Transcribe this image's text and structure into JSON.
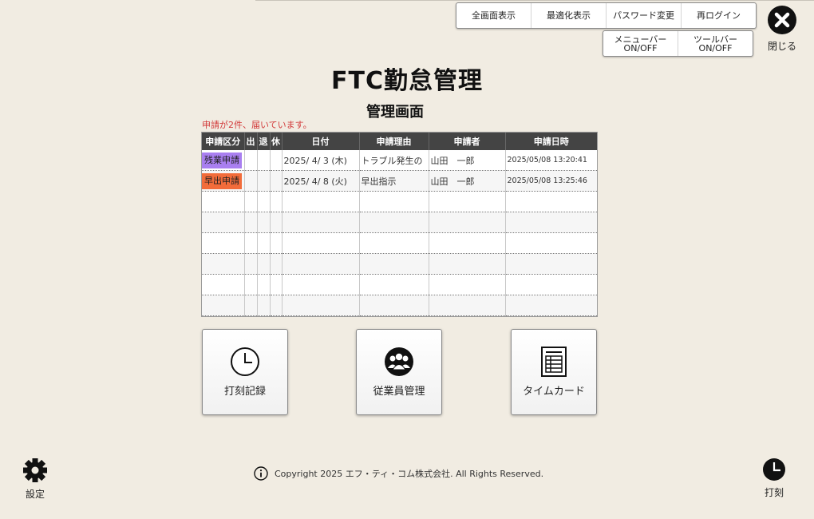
{
  "toolbar": {
    "fullscreen": "全画面表示",
    "maximize": "最適化表示",
    "change_password": "パスワード変更",
    "relogin": "再ログイン",
    "menubar_line1": "メニューバー",
    "menubar_line2": "ON/OFF",
    "toolbar_toggle": "ツールバーON/OFF"
  },
  "close": {
    "label": "閉じる",
    "icon": "close-circle-icon"
  },
  "title": "FTC勤怠管理",
  "subtitle": "管理画面",
  "notice": "申請が2件、届いています。",
  "table": {
    "headers": [
      "申請区分",
      "出",
      "退",
      "休",
      "日付",
      "申請理由",
      "申請者",
      "申請日時"
    ],
    "rows": [
      {
        "type": "残業申請",
        "type_color": "#a97ff0",
        "out": "",
        "leave": "",
        "rest": "",
        "date": "2025/ 4/ 3 (木)",
        "reason": "トラブル発生の",
        "applicant": "山田　一郎",
        "datetime": "2025/05/08 13:20:41"
      },
      {
        "type": "早出申請",
        "type_color": "#f26c3a",
        "out": "",
        "leave": "",
        "rest": "",
        "date": "2025/ 4/ 8 (火)",
        "reason": "早出指示",
        "applicant": "山田　一郎",
        "datetime": "2025/05/08 13:25:46"
      }
    ]
  },
  "buttons": {
    "timestamp": "打刻記録",
    "employees": "従業員管理",
    "timecard": "タイムカード"
  },
  "settings": {
    "label": "設定",
    "icon": "gear-icon"
  },
  "punch": {
    "label": "打刻",
    "icon": "clock-icon"
  },
  "copyright": "Copyright 2025 エフ・ティ・コム株式会社. All Rights Reserved."
}
